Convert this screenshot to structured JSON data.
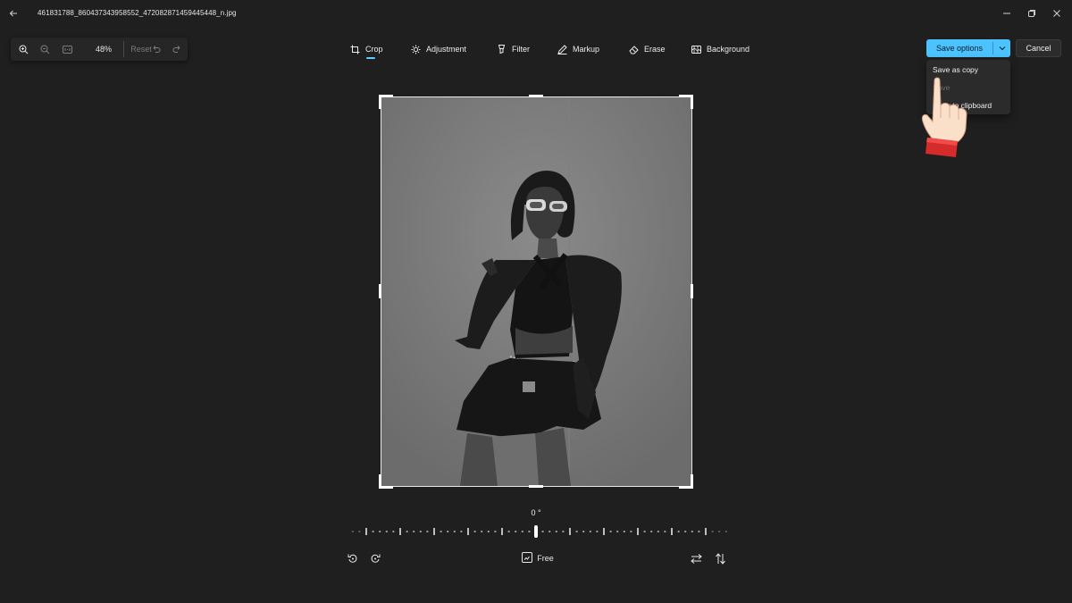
{
  "titlebar": {
    "filename": "461831788_860437343958552_472082871459445448_n.jpg",
    "icons": [
      "back-arrow-icon",
      "minimize-icon",
      "restore-icon",
      "close-icon"
    ]
  },
  "zoom_toolbar": {
    "zoom_level": "48%",
    "reset_label": "Reset",
    "icons": [
      "zoom-in-icon",
      "zoom-out-icon",
      "fit-icon",
      "undo-icon",
      "redo-icon"
    ]
  },
  "tools": [
    {
      "label": "Crop",
      "icon": "crop-icon",
      "active": true
    },
    {
      "label": "Adjustment",
      "icon": "sun-icon",
      "active": false
    },
    {
      "label": "Filter",
      "icon": "filter-icon",
      "active": false
    },
    {
      "label": "Markup",
      "icon": "pen-icon",
      "active": false
    },
    {
      "label": "Erase",
      "icon": "eraser-icon",
      "active": false
    },
    {
      "label": "Background",
      "icon": "background-icon",
      "active": false
    }
  ],
  "actions": {
    "save_options_label": "Save options",
    "cancel_label": "Cancel"
  },
  "save_menu": {
    "items": [
      {
        "label": "Save as copy",
        "enabled": true
      },
      {
        "label": "Save",
        "enabled": false
      },
      {
        "label": "Copy to clipboard",
        "enabled": true
      }
    ]
  },
  "rotation": {
    "angle_label": "0 °",
    "angle_value": 0
  },
  "bottom_bar": {
    "aspect_label": "Free",
    "icons": [
      "rotate-left-icon",
      "rotate-right-icon",
      "aspect-ratio-icon",
      "flip-horizontal-icon",
      "flip-vertical-icon"
    ]
  },
  "colors": {
    "background": "#1f1f1f",
    "accent": "#4cc2ff",
    "underline": "#60cdff"
  }
}
